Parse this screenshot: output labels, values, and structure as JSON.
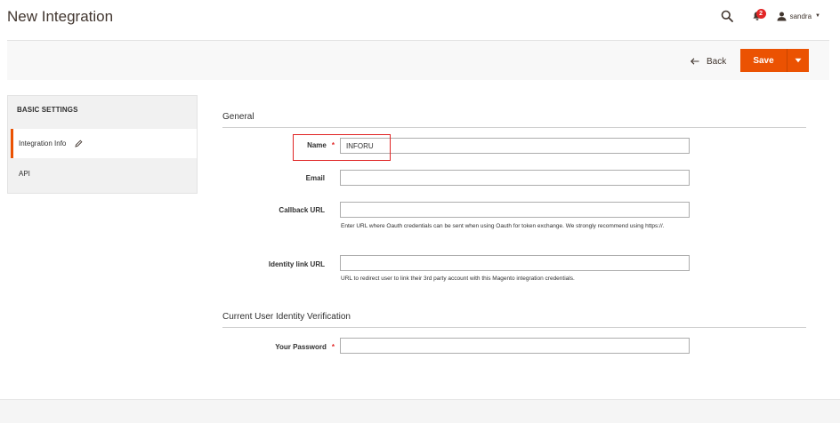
{
  "header": {
    "title": "New Integration",
    "notification_count": "2",
    "username": "sandra"
  },
  "actions": {
    "back_label": "Back",
    "save_label": "Save"
  },
  "sidebar": {
    "heading": "BASIC SETTINGS",
    "items": [
      {
        "label": "Integration Info",
        "active": true
      },
      {
        "label": "API",
        "active": false
      }
    ]
  },
  "form": {
    "general_title": "General",
    "name": {
      "label": "Name",
      "value": "INFORU",
      "required": true
    },
    "email": {
      "label": "Email",
      "value": ""
    },
    "callback_url": {
      "label": "Callback URL",
      "value": "",
      "note": "Enter URL where Oauth credentials can be sent when using Oauth for token exchange. We strongly recommend using https://."
    },
    "identity_link_url": {
      "label": "Identity link URL",
      "value": "",
      "note": "URL to redirect user to link their 3rd party account with this Magento integration credentials."
    },
    "verification_title": "Current User Identity Verification",
    "password": {
      "label": "Your Password",
      "value": "",
      "required": true
    }
  },
  "colors": {
    "accent": "#eb5202",
    "required": "#e22626",
    "highlight": "#e02424"
  }
}
